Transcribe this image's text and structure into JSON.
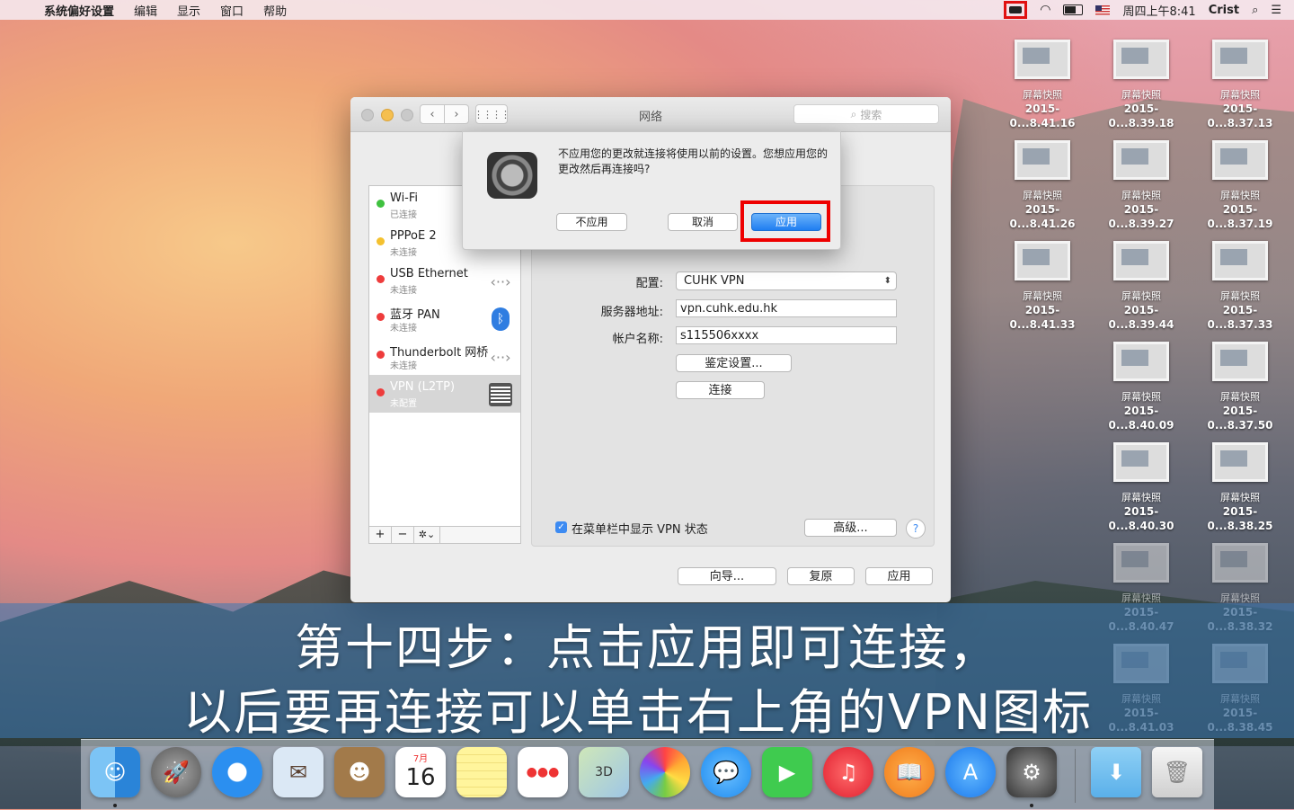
{
  "menubar": {
    "apple": "",
    "items": [
      "系统偏好设置",
      "编辑",
      "显示",
      "窗口",
      "帮助"
    ],
    "clock": "周四上午8:41",
    "user": "Crist",
    "status_icons": [
      "vpn-icon",
      "wifi-icon",
      "battery-icon",
      "flag-icon",
      "spotlight-icon",
      "notification-icon"
    ]
  },
  "desktop": {
    "files": [
      {
        "name1": "屏幕快照",
        "name2": "2015-0...8.41.16"
      },
      {
        "name1": "屏幕快照",
        "name2": "2015-0...8.39.18"
      },
      {
        "name1": "屏幕快照",
        "name2": "2015-0...8.37.13"
      },
      {
        "name1": "屏幕快照",
        "name2": "2015-0...8.41.26"
      },
      {
        "name1": "屏幕快照",
        "name2": "2015-0...8.39.27"
      },
      {
        "name1": "屏幕快照",
        "name2": "2015-0...8.37.19"
      },
      {
        "name1": "屏幕快照",
        "name2": "2015-0...8.41.33"
      },
      {
        "name1": "屏幕快照",
        "name2": "2015-0...8.39.44"
      },
      {
        "name1": "屏幕快照",
        "name2": "2015-0...8.37.33"
      },
      {
        "name1": "屏幕快照",
        "name2": "2015-0...8.40.09"
      },
      {
        "name1": "屏幕快照",
        "name2": "2015-0...8.37.50"
      },
      {
        "name1": "屏幕快照",
        "name2": "2015-0...8.40.30"
      },
      {
        "name1": "屏幕快照",
        "name2": "2015-0...8.38.25"
      },
      {
        "name1": "屏幕快照",
        "name2": "2015-0...8.40.47"
      },
      {
        "name1": "屏幕快照",
        "name2": "2015-0...8.38.32"
      },
      {
        "name1": "屏幕快照",
        "name2": "2015-0...8.41.03"
      },
      {
        "name1": "屏幕快照",
        "name2": "2015-0...8.38.45"
      }
    ]
  },
  "window": {
    "title": "网络",
    "search_placeholder": "搜索",
    "nav_back": "‹",
    "nav_fwd": "›",
    "grid": "⋮⋮⋮⋮"
  },
  "sidebar": {
    "services": [
      {
        "name": "Wi-Fi",
        "status": "已连接",
        "color": "#3fc13f",
        "icon": ""
      },
      {
        "name": "PPPoE 2",
        "status": "未连接",
        "color": "#f4c12f",
        "icon": "‹··›"
      },
      {
        "name": "USB Ethernet",
        "status": "未连接",
        "color": "#ee3c3c",
        "icon": "‹··›"
      },
      {
        "name": "蓝牙 PAN",
        "status": "未连接",
        "color": "#ee3c3c",
        "icon": "ᛒ"
      },
      {
        "name": "Thunderbolt 网桥",
        "status": "未连接",
        "color": "#ee3c3c",
        "icon": "‹··›"
      },
      {
        "name": "VPN (L2TP)",
        "status": "未配置",
        "color": "#ee3c3c",
        "icon": ""
      }
    ],
    "add": "+",
    "remove": "−",
    "gear": "✲⌄"
  },
  "form": {
    "config_label": "配置:",
    "config_value": "CUHK VPN",
    "server_label": "服务器地址:",
    "server_value": "vpn.cuhk.edu.hk",
    "account_label": "帐户名称:",
    "account_value": "s115506xxxx",
    "auth_button": "鉴定设置...",
    "connect_button": "连接",
    "show_vpn_status": "在菜单栏中显示 VPN 状态",
    "advanced_button": "高级...",
    "help": "?"
  },
  "footer": {
    "assist": "向导...",
    "revert": "复原",
    "apply": "应用"
  },
  "sheet": {
    "message": "不应用您的更改就连接将使用以前的设置。您想应用您的更改然后再连接吗?",
    "dont_apply": "不应用",
    "cancel": "取消",
    "apply": "应用"
  },
  "caption": {
    "line1": "第十四步：点击应用即可连接，",
    "line2": "以后要再连接可以单击右上角的VPN图标"
  },
  "dock": {
    "calendar_month": "7月",
    "calendar_day": "16",
    "apps": [
      "finder-icon",
      "launchpad-icon",
      "safari-icon",
      "mail-icon",
      "contacts-icon",
      "calendar-icon",
      "notes-icon",
      "reminders-icon",
      "maps-icon",
      "photos-icon",
      "messages-icon",
      "facetime-icon",
      "itunes-icon",
      "ibooks-icon",
      "appstore-icon",
      "system-preferences-icon",
      "downloads-folder-icon",
      "trash-icon"
    ]
  }
}
